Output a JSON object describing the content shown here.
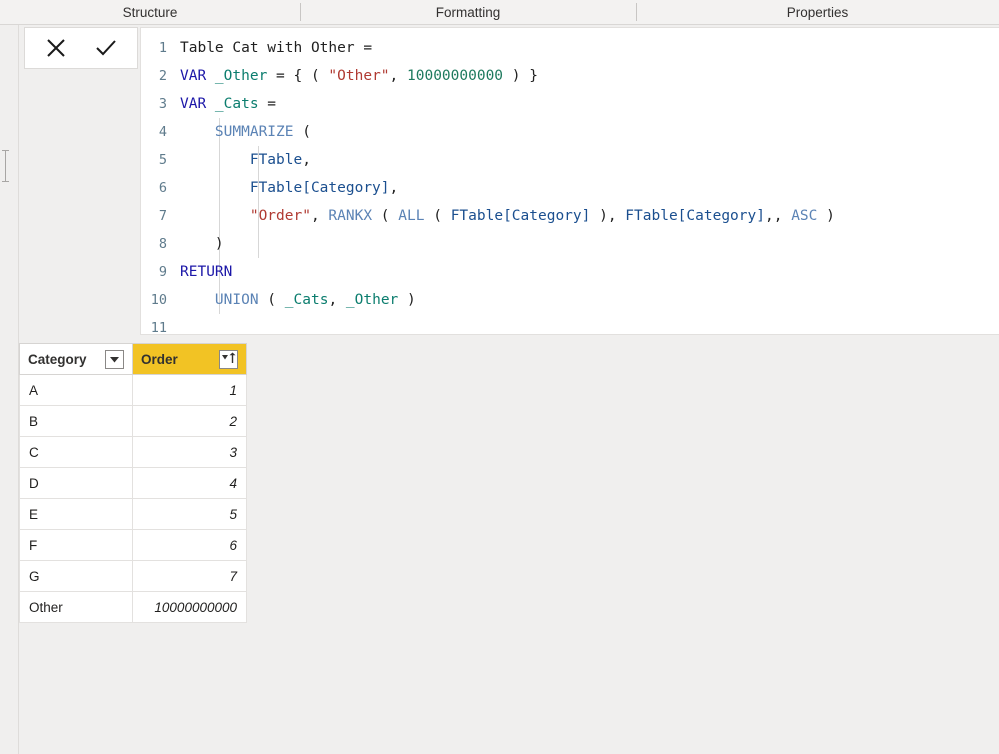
{
  "tabs": [
    {
      "label": "Structure",
      "name": "tab-structure"
    },
    {
      "label": "Formatting",
      "name": "tab-formatting"
    },
    {
      "label": "Properties",
      "name": "tab-properties"
    }
  ],
  "commit_bar": {
    "cancel_label": "close-icon",
    "confirm_label": "checkmark-icon"
  },
  "editor": {
    "lines": [
      {
        "num": "1",
        "tokens": [
          {
            "t": "Table Cat with Other =",
            "c": "pln"
          }
        ]
      },
      {
        "num": "2",
        "tokens": [
          {
            "t": "VAR ",
            "c": "kw"
          },
          {
            "t": "_Other",
            "c": "var"
          },
          {
            "t": " = { ( ",
            "c": "pln"
          },
          {
            "t": "\"Other\"",
            "c": "str"
          },
          {
            "t": ", ",
            "c": "pln"
          },
          {
            "t": "10000000000",
            "c": "num"
          },
          {
            "t": " ) }",
            "c": "pln"
          }
        ]
      },
      {
        "num": "3",
        "tokens": [
          {
            "t": "VAR ",
            "c": "kw"
          },
          {
            "t": "_Cats",
            "c": "var"
          },
          {
            "t": " =",
            "c": "pln"
          }
        ]
      },
      {
        "num": "4",
        "tokens": [
          {
            "t": "    ",
            "c": "pln"
          },
          {
            "t": "SUMMARIZE",
            "c": "fn"
          },
          {
            "t": " (",
            "c": "pln"
          }
        ]
      },
      {
        "num": "5",
        "tokens": [
          {
            "t": "        ",
            "c": "pln"
          },
          {
            "t": "FTable",
            "c": "col"
          },
          {
            "t": ",",
            "c": "pln"
          }
        ]
      },
      {
        "num": "6",
        "tokens": [
          {
            "t": "        ",
            "c": "pln"
          },
          {
            "t": "FTable[Category]",
            "c": "col"
          },
          {
            "t": ",",
            "c": "pln"
          }
        ]
      },
      {
        "num": "7",
        "tokens": [
          {
            "t": "        ",
            "c": "pln"
          },
          {
            "t": "\"Order\"",
            "c": "str"
          },
          {
            "t": ", ",
            "c": "pln"
          },
          {
            "t": "RANKX",
            "c": "fn"
          },
          {
            "t": " ( ",
            "c": "pln"
          },
          {
            "t": "ALL",
            "c": "fn"
          },
          {
            "t": " ( ",
            "c": "pln"
          },
          {
            "t": "FTable[Category]",
            "c": "col"
          },
          {
            "t": " ), ",
            "c": "pln"
          },
          {
            "t": "FTable[Category]",
            "c": "col"
          },
          {
            "t": ",, ",
            "c": "pln"
          },
          {
            "t": "ASC",
            "c": "fn"
          },
          {
            "t": " )",
            "c": "pln"
          }
        ]
      },
      {
        "num": "8",
        "tokens": [
          {
            "t": "    )",
            "c": "pln"
          }
        ]
      },
      {
        "num": "9",
        "tokens": [
          {
            "t": "RETURN",
            "c": "kw"
          }
        ]
      },
      {
        "num": "10",
        "tokens": [
          {
            "t": "    ",
            "c": "pln"
          },
          {
            "t": "UNION",
            "c": "fn"
          },
          {
            "t": " ( ",
            "c": "pln"
          },
          {
            "t": "_Cats",
            "c": "var"
          },
          {
            "t": ", ",
            "c": "pln"
          },
          {
            "t": "_Other",
            "c": "var"
          },
          {
            "t": " )",
            "c": "pln"
          }
        ]
      },
      {
        "num": "11",
        "tokens": []
      }
    ]
  },
  "result_table": {
    "columns": [
      {
        "label": "Category",
        "name": "column-header-category",
        "filter_icon": "chevron-down-icon",
        "sorted": false
      },
      {
        "label": "Order",
        "name": "column-header-order",
        "filter_icon": "sort-ascending-icon",
        "sorted": true
      }
    ],
    "highlight_color": "#f2c324",
    "rows": [
      {
        "category": "A",
        "order": "1"
      },
      {
        "category": "B",
        "order": "2"
      },
      {
        "category": "C",
        "order": "3"
      },
      {
        "category": "D",
        "order": "4"
      },
      {
        "category": "E",
        "order": "5"
      },
      {
        "category": "F",
        "order": "6"
      },
      {
        "category": "G",
        "order": "7"
      },
      {
        "category": "Other",
        "order": "10000000000"
      }
    ]
  }
}
